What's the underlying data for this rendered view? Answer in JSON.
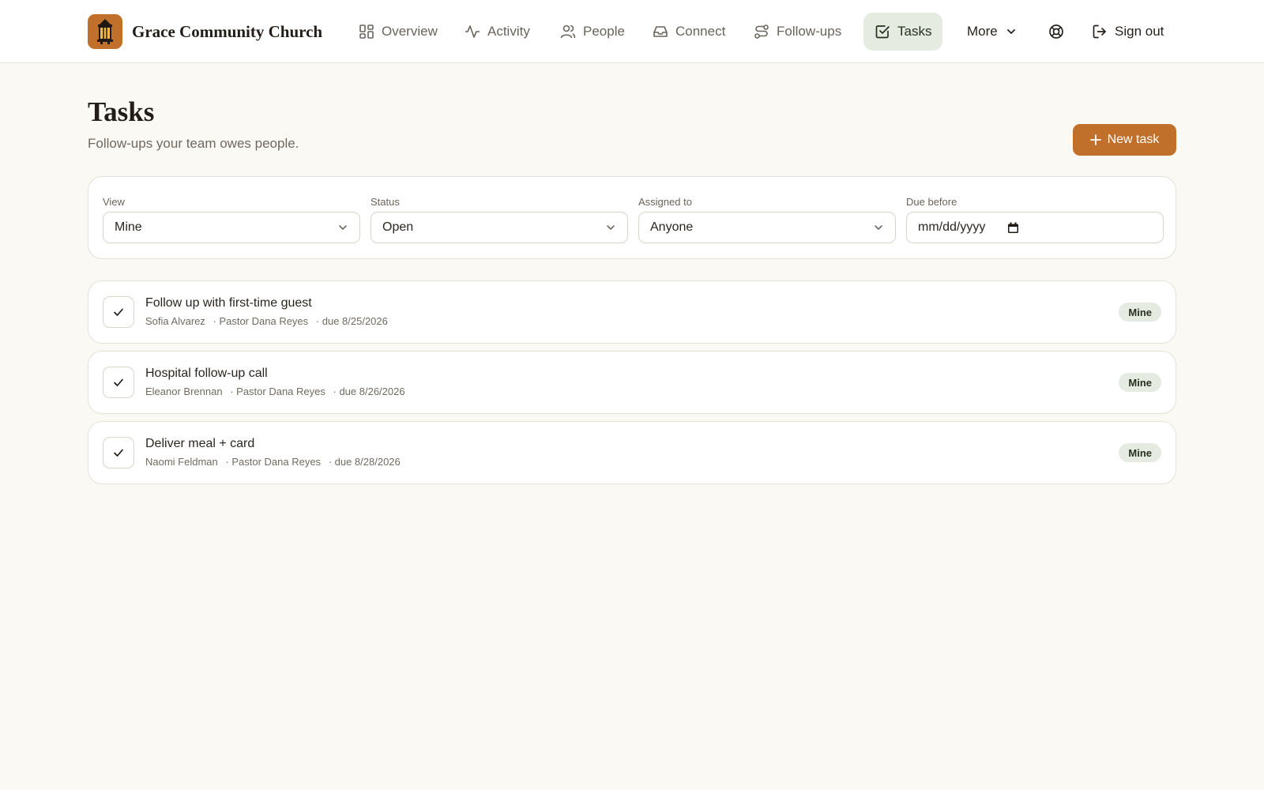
{
  "brand": {
    "name": "Grace Community Church",
    "logo_icon": "lantern-icon",
    "accent": "#c0702a"
  },
  "nav": {
    "items": [
      {
        "label": "Overview",
        "icon": "grid-icon"
      },
      {
        "label": "Activity",
        "icon": "activity-icon"
      },
      {
        "label": "People",
        "icon": "people-icon"
      },
      {
        "label": "Connect",
        "icon": "inbox-icon"
      },
      {
        "label": "Follow-ups",
        "icon": "route-icon"
      },
      {
        "label": "Tasks",
        "icon": "check-square-icon",
        "active": true
      },
      {
        "label": "More",
        "icon": "chevron-down-icon"
      }
    ],
    "help_icon": "lifebuoy-icon",
    "sign_out": "Sign out"
  },
  "page": {
    "title": "Tasks",
    "subtitle": "Follow-ups your team owes people.",
    "new_task": "New task"
  },
  "filters": {
    "view": {
      "label": "View",
      "value": "Mine"
    },
    "status": {
      "label": "Status",
      "value": "Open"
    },
    "assigned": {
      "label": "Assigned to",
      "value": "Anyone"
    },
    "due": {
      "label": "Due before",
      "placeholder": "mm/dd/yyyy"
    }
  },
  "tasks": [
    {
      "title": "Follow up with first-time guest",
      "person": "Sofia Alvarez",
      "assignee": "· Pastor Dana Reyes",
      "due": "· due 8/25/2026",
      "badge": "Mine"
    },
    {
      "title": "Hospital follow-up call",
      "person": "Eleanor Brennan",
      "assignee": "· Pastor Dana Reyes",
      "due": "· due 8/26/2026",
      "badge": "Mine"
    },
    {
      "title": "Deliver meal + card",
      "person": "Naomi Feldman",
      "assignee": "· Pastor Dana Reyes",
      "due": "· due 8/28/2026",
      "badge": "Mine"
    }
  ]
}
